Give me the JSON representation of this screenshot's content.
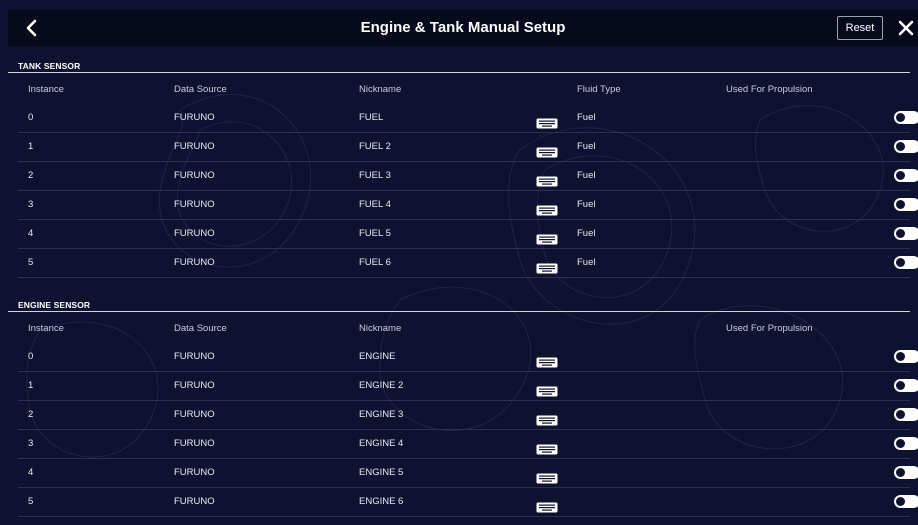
{
  "header": {
    "title": "Engine & Tank Manual Setup",
    "reset_label": "Reset",
    "back_icon": "chevron-left-icon",
    "close_icon": "close-icon"
  },
  "columns": {
    "instance": "Instance",
    "data_source": "Data Source",
    "nickname": "Nickname",
    "fluid_type": "Fluid Type",
    "used_for_propulsion": "Used For Propulsion"
  },
  "tank_sensor": {
    "title": "TANK SENSOR",
    "rows": [
      {
        "instance": "0",
        "source": "FURUNO",
        "nickname": "FUEL",
        "fluid": "Fuel",
        "propulsion": true
      },
      {
        "instance": "1",
        "source": "FURUNO",
        "nickname": "FUEL 2",
        "fluid": "Fuel",
        "propulsion": true
      },
      {
        "instance": "2",
        "source": "FURUNO",
        "nickname": "FUEL 3",
        "fluid": "Fuel",
        "propulsion": true
      },
      {
        "instance": "3",
        "source": "FURUNO",
        "nickname": "FUEL 4",
        "fluid": "Fuel",
        "propulsion": true
      },
      {
        "instance": "4",
        "source": "FURUNO",
        "nickname": "FUEL 5",
        "fluid": "Fuel",
        "propulsion": true
      },
      {
        "instance": "5",
        "source": "FURUNO",
        "nickname": "FUEL 6",
        "fluid": "Fuel",
        "propulsion": true
      }
    ]
  },
  "engine_sensor": {
    "title": "ENGINE SENSOR",
    "rows": [
      {
        "instance": "0",
        "source": "FURUNO",
        "nickname": "ENGINE",
        "propulsion": true
      },
      {
        "instance": "1",
        "source": "FURUNO",
        "nickname": "ENGINE 2",
        "propulsion": true
      },
      {
        "instance": "2",
        "source": "FURUNO",
        "nickname": "ENGINE 3",
        "propulsion": true
      },
      {
        "instance": "3",
        "source": "FURUNO",
        "nickname": "ENGINE 4",
        "propulsion": true
      },
      {
        "instance": "4",
        "source": "FURUNO",
        "nickname": "ENGINE 5",
        "propulsion": true
      },
      {
        "instance": "5",
        "source": "FURUNO",
        "nickname": "ENGINE 6",
        "propulsion": true
      }
    ]
  },
  "colors": {
    "background": "#0e1230",
    "header_bar": "#07091c",
    "text": "#e8eaf2",
    "divider": "#2b3050",
    "toggle_on": "#ffffff"
  }
}
